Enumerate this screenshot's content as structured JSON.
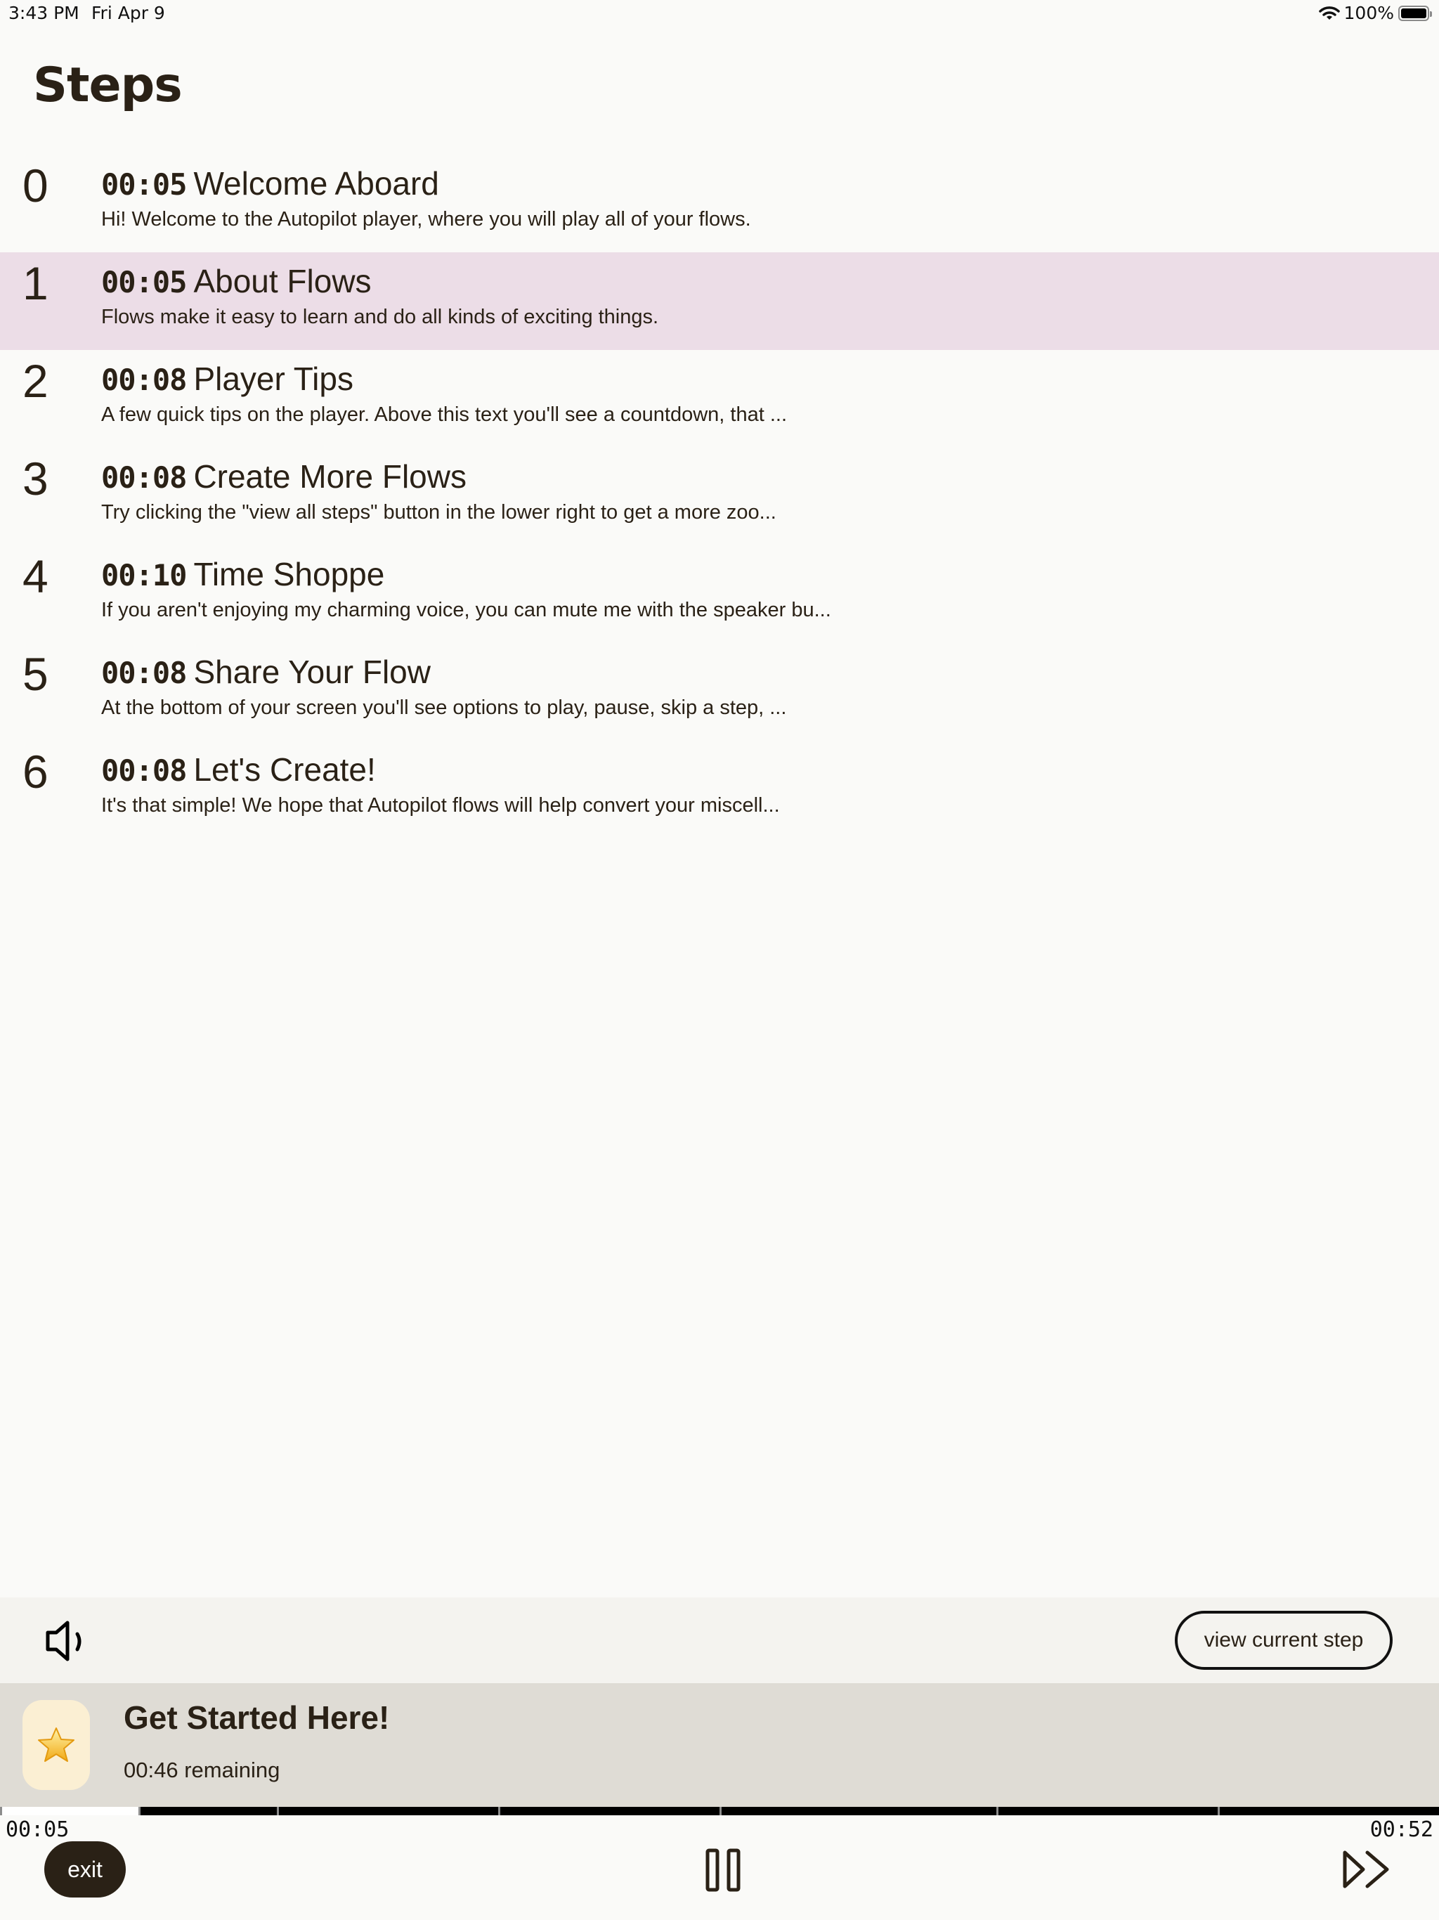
{
  "status_bar": {
    "time": "3:43 PM",
    "date": "Fri Apr 9",
    "battery_percent": "100%",
    "wifi_icon": "wifi-icon",
    "battery_icon": "battery-icon"
  },
  "page": {
    "title": "Steps"
  },
  "steps": [
    {
      "index": "0",
      "duration": "00:05",
      "title": "Welcome Aboard",
      "description": "Hi! Welcome to the Autopilot player, where you will play all of your flows.",
      "current": false
    },
    {
      "index": "1",
      "duration": "00:05",
      "title": "About Flows",
      "description": "Flows make it easy to learn and do all kinds of exciting things.",
      "current": true
    },
    {
      "index": "2",
      "duration": "00:08",
      "title": "Player Tips",
      "description": "A few quick tips on the player. Above this text you'll see a countdown, that ...",
      "current": false
    },
    {
      "index": "3",
      "duration": "00:08",
      "title": "Create More Flows",
      "description": "Try clicking the \"view all steps\" button in the lower right to get a more zoo...",
      "current": false
    },
    {
      "index": "4",
      "duration": "00:10",
      "title": "Time Shoppe",
      "description": "If you aren't enjoying my charming voice, you can mute me with the speaker bu...",
      "current": false
    },
    {
      "index": "5",
      "duration": "00:08",
      "title": "Share Your Flow",
      "description": "At the bottom of your screen you'll see options to play, pause, skip a step, ...",
      "current": false
    },
    {
      "index": "6",
      "duration": "00:08",
      "title": "Let's Create!",
      "description": "It's that simple! We hope that Autopilot flows will help convert your miscell...",
      "current": false
    }
  ],
  "controls": {
    "speaker_icon": "speaker-icon",
    "view_current_step_label": "view current step"
  },
  "now_playing": {
    "icon": "⭐",
    "icon_name": "star-icon",
    "title": "Get Started Here!",
    "remaining": "00:46 remaining"
  },
  "progress": {
    "elapsed": "00:05",
    "total": "00:52",
    "elapsed_fraction": 0.096,
    "step_durations_seconds": [
      5,
      5,
      8,
      8,
      10,
      8,
      8
    ]
  },
  "player": {
    "exit_label": "exit",
    "pause_icon": "pause-icon",
    "skip_icon": "skip-forward-icon"
  },
  "colors": {
    "text": "#2a2116",
    "current_step_bg": "#ecdde7",
    "now_playing_bg": "#dfdcd5",
    "control_strip_bg": "#f4f3ef",
    "icon_tile_bg": "#fbefd3",
    "page_bg": "#fafaf8"
  }
}
